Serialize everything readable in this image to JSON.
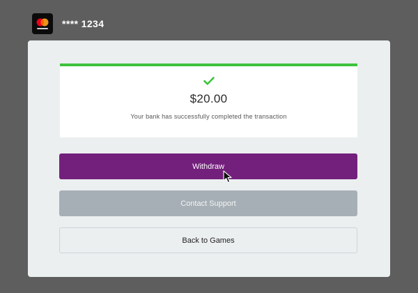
{
  "card": {
    "logo_icon": "mastercard-logo-icon",
    "number": "**** 1234"
  },
  "result": {
    "status_icon": "checkmark-icon",
    "amount": "$20.00",
    "message": "Your bank has successfully completed the transaction"
  },
  "actions": {
    "withdraw_label": "Withdraw",
    "contact_support_label": "Contact Support",
    "back_to_games_label": "Back to Games"
  },
  "colors": {
    "background": "#5e5e5e",
    "panel": "#eceff0",
    "success_green": "#3ec33e",
    "primary_purple": "#73207c",
    "secondary_gray": "#a6afb5"
  }
}
